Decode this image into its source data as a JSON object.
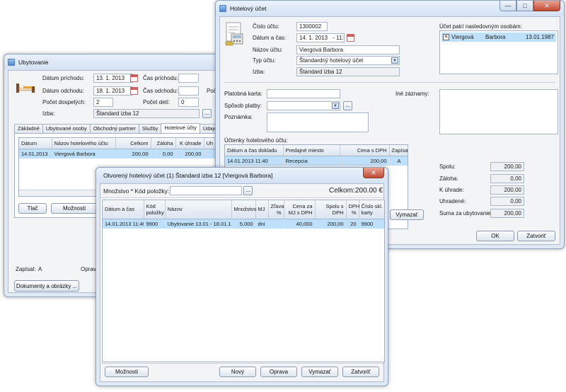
{
  "ubytovanie": {
    "title": "Ubytovanie",
    "datum_prichodu_label": "Dátum príchodu:",
    "datum_prichodu": "13. 1. 2013",
    "cas_prichodu_label": "Čas príchodu:",
    "datum_odchodu_label": "Dátum odchodu:",
    "datum_odchodu": "18. 1. 2013",
    "cas_odchodu_label": "Čas odchodu:",
    "poc_label": "Poč",
    "pocet_dospelych_label": "Počet dospelých:",
    "pocet_dospelych": "2",
    "pocet_deti_label": "Počet detí:",
    "pocet_deti": "0",
    "izba_label": "Izba:",
    "izba": "Štandard izba 12",
    "browse": "...",
    "tabs": [
      "Základné",
      "Ubytované osoby",
      "Obchodný partner",
      "Služby",
      "Hotelové účty",
      "Údaje z rez"
    ],
    "grid_headers": [
      "Dátum",
      "Názov hotelového účtu",
      "Celkom",
      "Záloha",
      "K úhrade",
      "Uh"
    ],
    "grid_rows": [
      [
        "14.01.2013",
        "Viergová Barbora",
        "200,00",
        "0,00",
        "200,00",
        ""
      ]
    ],
    "tlac": "Tlač",
    "moznosti": "Možnosti",
    "zapisal_label": "Zapísal:",
    "zapisal": "A",
    "opravil_label": "Opravil",
    "dokumenty": "Dokumenty a obrázky ..."
  },
  "hotelovy": {
    "title": "Hotelový účet",
    "cislo_label": "Číslo účtu:",
    "cislo": "1300002",
    "datum_cas_label": "Dátum a čas:",
    "datum": "14. 1. 2013",
    "cas": "- 11:40",
    "nazov_label": "Názov účtu:",
    "nazov": "Viergová Barbora",
    "typ_label": "Typ účtu:",
    "typ": "Štandardný hotelový účet",
    "izba_label": "Izba:",
    "izba": "Štandard izba 12",
    "osoby_label": "Účet patrí nasledovným osobám:",
    "osoby": [
      {
        "priezvisko": "Viergová",
        "meno": "Barbora",
        "datum": "13.01.1987"
      }
    ],
    "platobna_label": "Platobná karta:",
    "sposob_label": "Spôsob platby:",
    "poznamka_label": "Poznámka:",
    "ine_label": "Iné záznamy:",
    "uctenky_label": "Účtenky hotelového účtu:",
    "uctenky_headers": [
      "Dátum a čas dokladu",
      "Predajné miesto",
      "Cena s DPH",
      "Zapísal"
    ],
    "uctenky_rows": [
      [
        "14.01.2013 11:40",
        "Recepcia",
        "200,00",
        "A"
      ]
    ],
    "browse": "...",
    "vymazat": "Vymazať",
    "spolu_label": "Spolu:",
    "spolu": "200,00",
    "zaloha_label": "Záloha:",
    "zaloha": "0,00",
    "k_uhrade_label": "K úhrade:",
    "k_uhrade": "200,00",
    "uhradene_label": "Uhradené:",
    "uhradene": "0,00",
    "suma_label": "Suma za ubytovanie:",
    "suma": "200,00",
    "ok": "OK",
    "zatvorit": "Zatvoriť"
  },
  "otvoreny": {
    "title": "Otvorený hotelový účet (1) Štandard izba 12  [Viergová Barbora]",
    "mnozstvo_label": "Množstvo * Kód položky:",
    "browse": "...",
    "celkom_label": "Celkom:",
    "celkom": "200.00 €",
    "headers": [
      "Dátum a čas",
      "Kód položky",
      "Názov",
      "Množstvo",
      "MJ",
      "Zľava %",
      "Cena za MJ s DPH",
      "Spolu s DPH",
      "DPH %",
      "Číslo skl. karty"
    ],
    "rows": [
      [
        "14.01.2013 11:40",
        "9900",
        "Ubytovanie  13.01 - 18.01.13",
        "5,000",
        "dni",
        "",
        "40,000",
        "200,00",
        "20",
        "9900"
      ]
    ],
    "moznosti": "Možnosti",
    "novy": "Nový",
    "oprava": "Oprava",
    "vymazat": "Vymazať",
    "zatvorit": "Zatvoriť"
  },
  "icons": [
    "app-window-icon",
    "calendar-icon",
    "bed-icon",
    "invoice-icon",
    "checkbox-icon",
    "dropdown-arrow-icon",
    "minimize-icon",
    "maximize-icon",
    "close-icon"
  ]
}
